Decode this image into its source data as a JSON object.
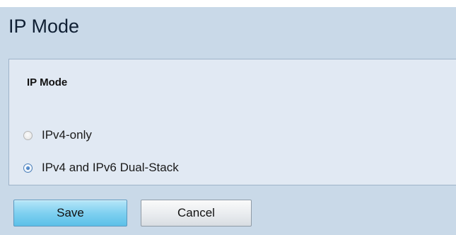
{
  "page": {
    "title": "IP Mode"
  },
  "panel": {
    "heading": "IP Mode",
    "options": [
      {
        "label": "IPv4-only",
        "selected": false
      },
      {
        "label": "IPv4 and IPv6 Dual-Stack",
        "selected": true
      }
    ]
  },
  "actions": {
    "save_label": "Save",
    "cancel_label": "Cancel"
  },
  "colors": {
    "page_background": "#c9d9e8",
    "panel_background": "#e1e9f3",
    "save_button": "#7fd0f0",
    "cancel_button": "#e9ecef"
  }
}
